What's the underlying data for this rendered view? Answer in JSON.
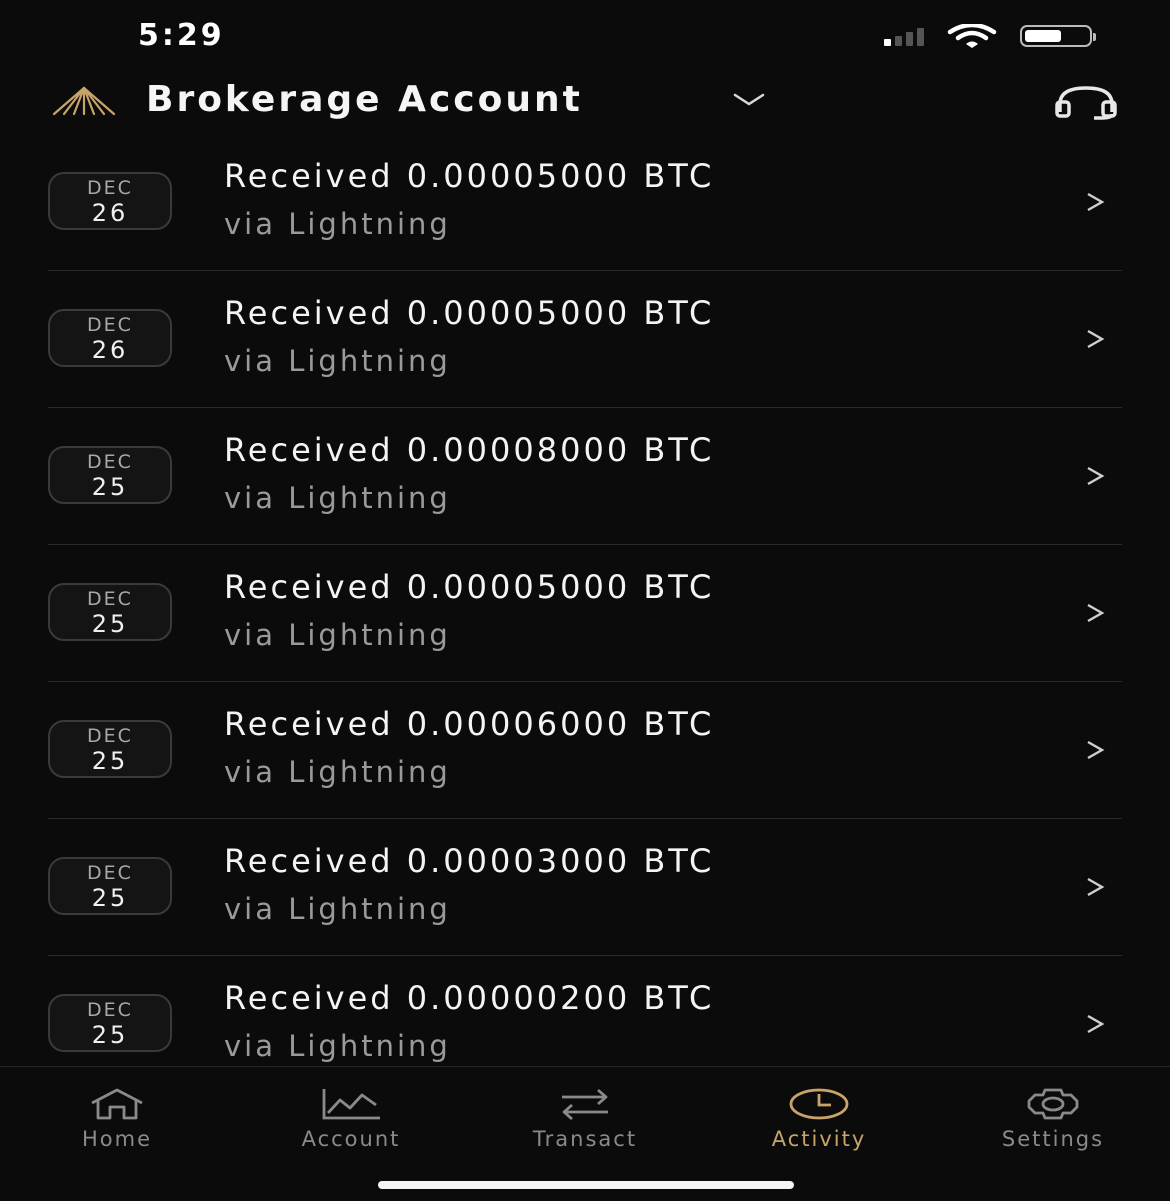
{
  "status_bar": {
    "time": "5:29"
  },
  "header": {
    "title": "Brokerage Account"
  },
  "activity": [
    {
      "month": "DEC",
      "day": "26",
      "title": "Received 0.00005000 BTC",
      "subtitle": "via Lightning"
    },
    {
      "month": "DEC",
      "day": "26",
      "title": "Received 0.00005000 BTC",
      "subtitle": "via Lightning"
    },
    {
      "month": "DEC",
      "day": "25",
      "title": "Received 0.00008000 BTC",
      "subtitle": "via Lightning"
    },
    {
      "month": "DEC",
      "day": "25",
      "title": "Received 0.00005000 BTC",
      "subtitle": "via Lightning"
    },
    {
      "month": "DEC",
      "day": "25",
      "title": "Received 0.00006000 BTC",
      "subtitle": "via Lightning"
    },
    {
      "month": "DEC",
      "day": "25",
      "title": "Received 0.00003000 BTC",
      "subtitle": "via Lightning"
    },
    {
      "month": "DEC",
      "day": "25",
      "title": "Received 0.00000200 BTC",
      "subtitle": "via Lightning"
    }
  ],
  "row_chevron": ">",
  "nav": {
    "items": [
      {
        "label": "Home",
        "icon": "home-icon"
      },
      {
        "label": "Account",
        "icon": "chart-icon"
      },
      {
        "label": "Transact",
        "icon": "transfer-icon"
      },
      {
        "label": "Activity",
        "icon": "clock-icon"
      },
      {
        "label": "Settings",
        "icon": "gear-icon"
      }
    ],
    "active_index": 3
  },
  "colors": {
    "background": "#0b0b0b",
    "accent": "#c9a46a",
    "muted": "#8a8a8a"
  }
}
